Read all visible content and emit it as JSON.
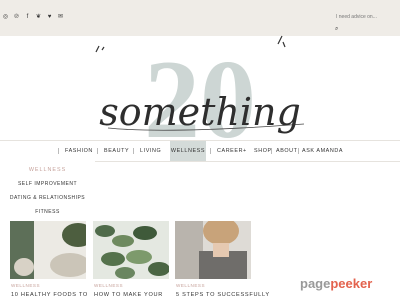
{
  "social": {
    "icons": [
      "instagram-icon",
      "pinterest-icon",
      "facebook-icon",
      "twitter-icon",
      "heart-icon",
      "email-icon"
    ],
    "glyphs": [
      "◎",
      "℗",
      "f",
      "❦",
      "♥",
      "✉"
    ]
  },
  "search": {
    "placeholder": "I need advice on...",
    "icon_glyph": "⌕"
  },
  "logo": {
    "number": "20",
    "script": "something"
  },
  "nav": {
    "items": [
      {
        "label": "FASHION"
      },
      {
        "label": "BEAUTY"
      },
      {
        "label": "LIVING"
      },
      {
        "label": "WELLNESS"
      },
      {
        "label": "CAREER"
      },
      {
        "label": "SHOP"
      },
      {
        "label": "ABOUT"
      },
      {
        "label": "ASK AMANDA"
      }
    ],
    "plus": "+"
  },
  "dropdown": {
    "heading": "WELLNESS",
    "items": [
      "SELF IMPROVEMENT",
      "DATING & RELATIONSHIPS",
      "FITNESS"
    ]
  },
  "posts": [
    {
      "category": "WELLNESS",
      "title": "10 HEALTHY FOODS TO"
    },
    {
      "category": "WELLNESS",
      "title": "HOW TO MAKE YOUR"
    },
    {
      "category": "WELLNESS",
      "title": "5 STEPS TO SUCCESSFULLY"
    }
  ],
  "watermark": {
    "main": "page",
    "accent": "peeker"
  },
  "colors": {
    "topbar": "#efece7",
    "accent": "#c6a29b",
    "nav_active": "#d4dbd9",
    "logo_number": "#cdd6d4"
  }
}
